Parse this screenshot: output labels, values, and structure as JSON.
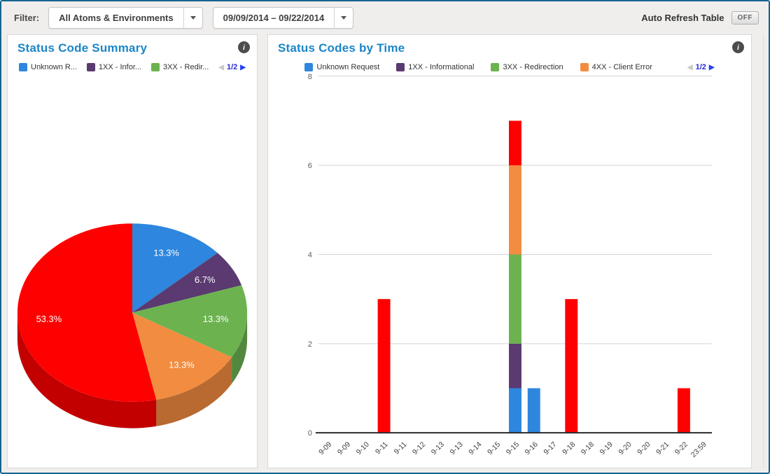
{
  "topbar": {
    "filter_label": "Filter:",
    "atoms_dropdown": "All Atoms & Environments",
    "date_dropdown": "09/09/2014 – 09/22/2014",
    "auto_refresh_label": "Auto Refresh Table",
    "auto_refresh_state": "OFF"
  },
  "icons": {
    "info": "i",
    "page_prev": "◀",
    "page_next": "▶"
  },
  "colors": {
    "title_blue": "#1a86c8",
    "frame_border": "#15648f",
    "series_blue": "#2e86de",
    "series_purple": "#5a3a70",
    "series_green": "#6cb350",
    "series_orange": "#f28c40",
    "series_red": "#ff0000",
    "pager_blue": "#2441f5"
  },
  "pie_panel": {
    "title": "Status Code Summary",
    "legend": [
      {
        "label": "Unknown R...",
        "color": "#2e86de"
      },
      {
        "label": "1XX - Infor...",
        "color": "#5a3a70"
      },
      {
        "label": "3XX - Redir...",
        "color": "#6cb350"
      }
    ],
    "pagination": "1/2"
  },
  "bar_panel": {
    "title": "Status Codes by Time",
    "legend": [
      {
        "label": "Unknown Request",
        "color": "#2e86de"
      },
      {
        "label": "1XX - Informational",
        "color": "#5a3a70"
      },
      {
        "label": "3XX - Redirection",
        "color": "#6cb350"
      },
      {
        "label": "4XX - Client Error",
        "color": "#f28c40"
      }
    ],
    "pagination": "1/2"
  },
  "chart_data": [
    {
      "type": "pie",
      "title": "Status Code Summary",
      "style": "3d",
      "start_angle_deg": 0,
      "direction": "clockwise",
      "slices": [
        {
          "label": "Unknown Request",
          "value": 13.3,
          "display": "13.3%",
          "color": "#2e86de"
        },
        {
          "label": "1XX - Informational",
          "value": 6.7,
          "display": "6.7%",
          "color": "#5a3a70"
        },
        {
          "label": "3XX - Redirection",
          "value": 13.3,
          "display": "13.3%",
          "color": "#6cb350"
        },
        {
          "label": "4XX - Client Error",
          "value": 13.3,
          "display": "13.3%",
          "color": "#f28c40"
        },
        {
          "label": "",
          "value": 53.3,
          "display": "53.3%",
          "color": "#ff0000"
        }
      ]
    },
    {
      "type": "bar",
      "stacked": true,
      "title": "Status Codes by Time",
      "grid": true,
      "legend_position": "top",
      "ylim": [
        0,
        8
      ],
      "yticks": [
        0,
        2,
        4,
        6,
        8
      ],
      "categories": [
        "9-09",
        "9-09",
        "9-10",
        "9-11",
        "9-11",
        "9-12",
        "9-13",
        "9-13",
        "9-14",
        "9-15",
        "9-15",
        "9-16",
        "9-17",
        "9-18",
        "9-18",
        "9-19",
        "9-20",
        "9-20",
        "9-21",
        "9-22",
        "23:59"
      ],
      "series": [
        {
          "name": "Unknown Request",
          "color": "#2e86de",
          "values": [
            0,
            0,
            0,
            0,
            0,
            0,
            0,
            0,
            0,
            0,
            1,
            1,
            0,
            0,
            0,
            0,
            0,
            0,
            0,
            0,
            0
          ]
        },
        {
          "name": "1XX - Informational",
          "color": "#5a3a70",
          "values": [
            0,
            0,
            0,
            0,
            0,
            0,
            0,
            0,
            0,
            0,
            1,
            0,
            0,
            0,
            0,
            0,
            0,
            0,
            0,
            0,
            0
          ]
        },
        {
          "name": "3XX - Redirection",
          "color": "#6cb350",
          "values": [
            0,
            0,
            0,
            0,
            0,
            0,
            0,
            0,
            0,
            0,
            2,
            0,
            0,
            0,
            0,
            0,
            0,
            0,
            0,
            0,
            0
          ]
        },
        {
          "name": "4XX - Client Error",
          "color": "#f28c40",
          "values": [
            0,
            0,
            0,
            0,
            0,
            0,
            0,
            0,
            0,
            0,
            2,
            0,
            0,
            0,
            0,
            0,
            0,
            0,
            0,
            0,
            0
          ]
        },
        {
          "name": "",
          "color": "#ff0000",
          "values": [
            0,
            0,
            0,
            3,
            0,
            0,
            0,
            0,
            0,
            0,
            1,
            0,
            0,
            3,
            0,
            0,
            0,
            0,
            0,
            1,
            0
          ]
        }
      ]
    }
  ]
}
